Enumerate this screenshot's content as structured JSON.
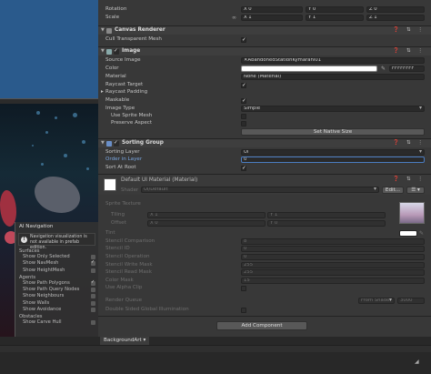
{
  "transform": {
    "rotation_label": "Rotation",
    "scale_label": "Scale",
    "rotation": {
      "x": "X 0",
      "y": "Y 0",
      "z": "Z 0"
    },
    "scale": {
      "x": "X 1",
      "y": "Y 1",
      "z": "Z 1"
    }
  },
  "canvas_renderer": {
    "title": "Canvas Renderer",
    "cull_label": "Cull Transparent Mesh",
    "cull": true
  },
  "image": {
    "title": "Image",
    "source_label": "Source Image",
    "source_value": "AbandonedStationKymarahl01",
    "color_label": "Color",
    "color_hex": "FFFFFFFF",
    "material_label": "Material",
    "material_value": "None (Material)",
    "raycast_target_label": "Raycast Target",
    "raycast_padding_label": "Raycast Padding",
    "maskable_label": "Maskable",
    "image_type_label": "Image Type",
    "image_type_value": "Simple",
    "use_sprite_mesh_label": "Use Sprite Mesh",
    "preserve_aspect_label": "Preserve Aspect",
    "set_native_size": "Set Native Size"
  },
  "sorting_group": {
    "title": "Sorting Group",
    "sorting_layer_label": "Sorting Layer",
    "sorting_layer_value": "UI",
    "order_label": "Order in Layer",
    "order_value": "0",
    "sort_root_label": "Sort At Root"
  },
  "material": {
    "title": "Default UI Material (Material)",
    "shader_label": "Shader",
    "shader_value": "UI/Default",
    "edit_label": "Edit...",
    "menu_label": "☰ ▾",
    "sprite_texture_label": "Sprite Texture",
    "tiling_label": "Tiling",
    "offset_label": "Offset",
    "tiling": {
      "x": "X 1",
      "y": "Y 1"
    },
    "offset": {
      "x": "X 0",
      "y": "Y 0"
    },
    "tint_label": "Tint",
    "props": [
      {
        "label": "Stencil Comparison",
        "value": "8"
      },
      {
        "label": "Stencil ID",
        "value": "0"
      },
      {
        "label": "Stencil Operation",
        "value": "0"
      },
      {
        "label": "Stencil Write Mask",
        "value": "255"
      },
      {
        "label": "Stencil Read Mask",
        "value": "255"
      },
      {
        "label": "Color Mask",
        "value": "15"
      }
    ],
    "alpha_clip_label": "Use Alpha Clip",
    "render_queue_label": "Render Queue",
    "render_queue_mode": "From Shader",
    "render_queue_value": "3000",
    "double_sided_label": "Double Sided Global Illumination"
  },
  "add_component": "Add Component",
  "bottom": {
    "tab": "BackgroundArt ▾"
  },
  "ai_nav": {
    "title": "AI Navigation",
    "note": "Navigation visualization is not available in prefab edition.",
    "surfaces_label": "Surfaces",
    "surfaces": [
      "Show Only Selected",
      "Show NavMesh",
      "Show HeightMesh"
    ],
    "agents_label": "Agents",
    "agents": [
      "Show Path Polygons",
      "Show Path Query Nodes",
      "Show Neighbours",
      "Show Walls",
      "Show Avoidance"
    ],
    "obstacles_label": "Obstacles",
    "obstacles": [
      "Show Carve Hull"
    ]
  },
  "colors": {
    "accent_blue": "#7aa6e0",
    "scene_sky": "#2a5a8c"
  }
}
